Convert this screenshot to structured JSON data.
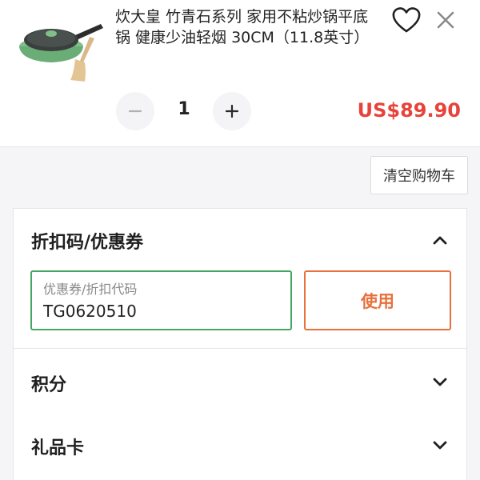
{
  "cart_item": {
    "title": "炊大皇 竹青石系列 家用不粘炒锅平底锅 健康少油轻烟 30CM（11.8英寸）",
    "image_icon": "green-wok-with-bamboo-spatula",
    "favorite_icon": "heart-icon",
    "remove_icon": "close-icon",
    "quantity": "1",
    "minus_icon": "minus-icon",
    "plus_icon": "plus-icon",
    "price": "US$89.90",
    "price_color": "#e8433a"
  },
  "clear_cart_label": "清空购物车",
  "coupon": {
    "title": "折扣码/优惠券",
    "expanded": true,
    "input_label": "优惠券/折扣代码",
    "input_value": "TG0620510",
    "apply_label": "使用",
    "accent_color": "#e8703d",
    "input_border_color": "#45a565"
  },
  "points": {
    "title": "积分",
    "expanded": false
  },
  "gift_card": {
    "title": "礼品卡",
    "expanded": false
  }
}
